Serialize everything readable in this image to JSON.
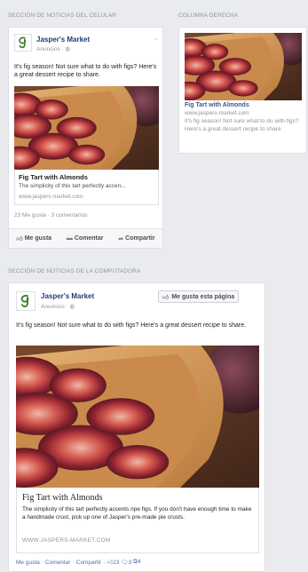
{
  "sections": {
    "mobile_label": "SECCIÓN DE NOTICIAS DEL CELULAR",
    "right_label": "COLUMNA DERECHA",
    "desktop_label": "SECCIÓN DE NOTICIAS DE LA COMPUTADORA"
  },
  "mobile_post": {
    "page_name": "Jasper's Market",
    "sponsored": "Anuncios · ",
    "text": "It's fig season! Not sure what to do with figs? Here's a great dessert recipe to share.",
    "link_title": "Fig Tart with Almonds",
    "link_desc": "The simplicity of this tart perfectly accen...",
    "link_domain": "www.jaspers-market.com",
    "counts": "23 Me gusta · 3 comentarios",
    "actions": {
      "like": "Me gusta",
      "comment": "Comentar",
      "share": "Compartir"
    }
  },
  "right_column": {
    "title": "Fig Tart with Almonds",
    "domain": "www.jaspers-market.com",
    "text": "It's fig season! Not sure what to do with figs? Here's a great dessert recipe to share."
  },
  "desktop_post": {
    "page_name": "Jasper's Market",
    "sponsored": "Anuncios · ",
    "like_page": "Me gusta esta página",
    "text": "It's fig season! Not sure what to do with figs? Here's a great dessert recipe to share.",
    "link_title": "Fig Tart with Almonds",
    "link_desc": "The simplicity of this tart perfectly accents ripe figs. If you don't have enough time to make a handmade crust, pick up one of Jasper's pre-made pie crusts.",
    "link_domain": "WWW.JASPERS-MARKET.COM",
    "actions": {
      "like": "Me gusta",
      "comment": "Comentar",
      "share": "Compartir",
      "likes_count": "23",
      "comments_count": "3",
      "shares_count": "4"
    }
  },
  "icons": {
    "like": "thumbs-up-icon",
    "comment": "speech-bubble-icon",
    "share": "share-arrow-icon",
    "globe": "globe-icon",
    "chevron": "chevron-down-icon"
  },
  "colors": {
    "background": "#e9ebee",
    "link_blue": "#365899",
    "name_blue": "#1c3d78",
    "logo_green": "#3a7a2a"
  }
}
